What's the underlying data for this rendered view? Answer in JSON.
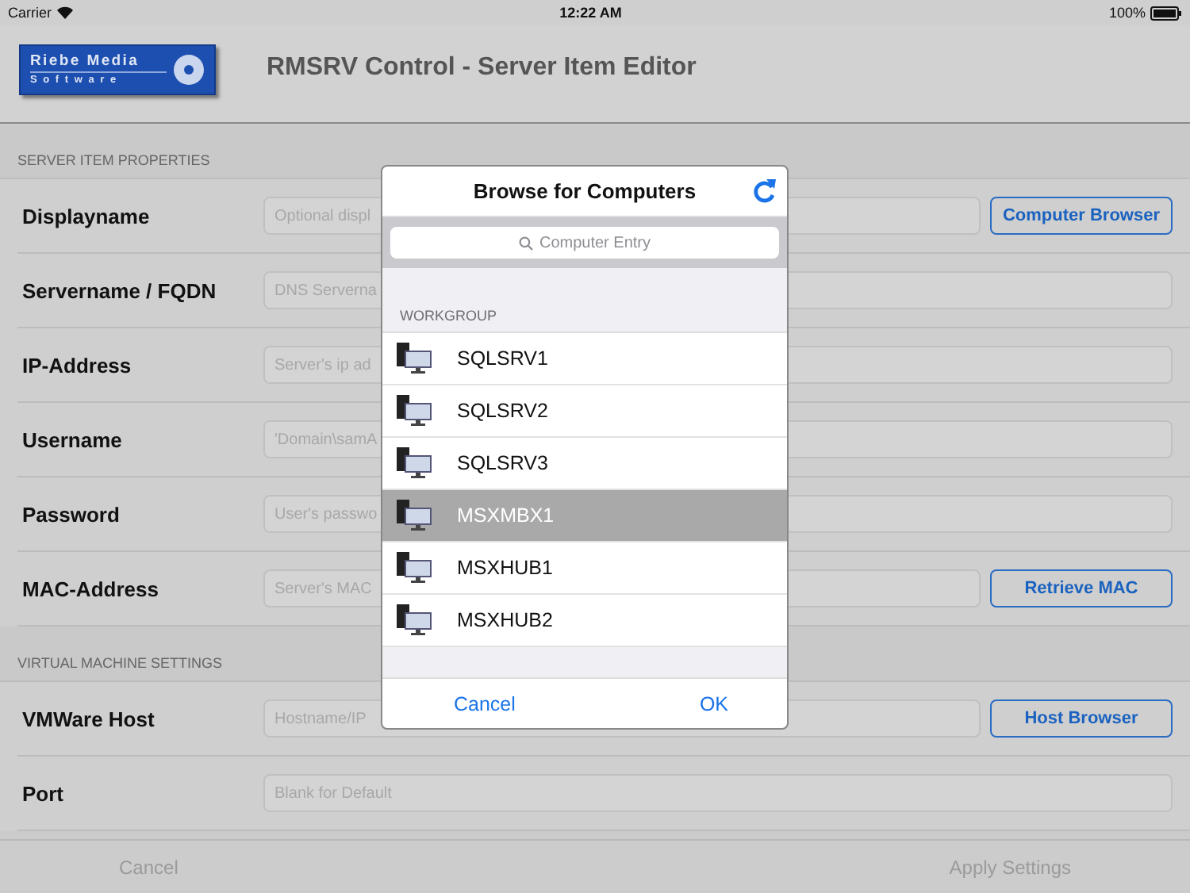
{
  "status_bar": {
    "carrier": "Carrier",
    "time": "12:22 AM",
    "battery": "100%"
  },
  "header": {
    "logo_line_1": "Riebe Media",
    "logo_line_2": "S o f t w a r e",
    "title": "RMSRV Control - Server Item Editor"
  },
  "sections": [
    {
      "title": "SERVER ITEM PROPERTIES",
      "rows": [
        {
          "label": "Displayname",
          "placeholder": "Optional displ",
          "button": "Computer Browser"
        },
        {
          "label": "Servername / FQDN",
          "placeholder": "DNS Serverna"
        },
        {
          "label": "IP-Address",
          "placeholder": "Server's ip ad"
        },
        {
          "label": "Username",
          "placeholder": "'Domain\\samA"
        },
        {
          "label": "Password",
          "placeholder": "User's passwo"
        },
        {
          "label": "MAC-Address",
          "placeholder": "Server's MAC",
          "button": "Retrieve MAC"
        }
      ]
    },
    {
      "title": "VIRTUAL MACHINE SETTINGS",
      "rows": [
        {
          "label": "VMWare Host",
          "placeholder": "Hostname/IP",
          "button": "Host Browser"
        },
        {
          "label": "Port",
          "placeholder": "Blank for Default"
        }
      ]
    }
  ],
  "toolbar": {
    "cancel": "Cancel",
    "apply": "Apply Settings"
  },
  "popover": {
    "title": "Browse for Computers",
    "search_placeholder": "Computer Entry",
    "group": "WORKGROUP",
    "items": [
      {
        "name": "SQLSRV1",
        "selected": false
      },
      {
        "name": "SQLSRV2",
        "selected": false
      },
      {
        "name": "SQLSRV3",
        "selected": false
      },
      {
        "name": "MSXMBX1",
        "selected": true
      },
      {
        "name": "MSXHUB1",
        "selected": false
      },
      {
        "name": "MSXHUB2",
        "selected": false
      }
    ],
    "cancel": "Cancel",
    "ok": "OK"
  }
}
